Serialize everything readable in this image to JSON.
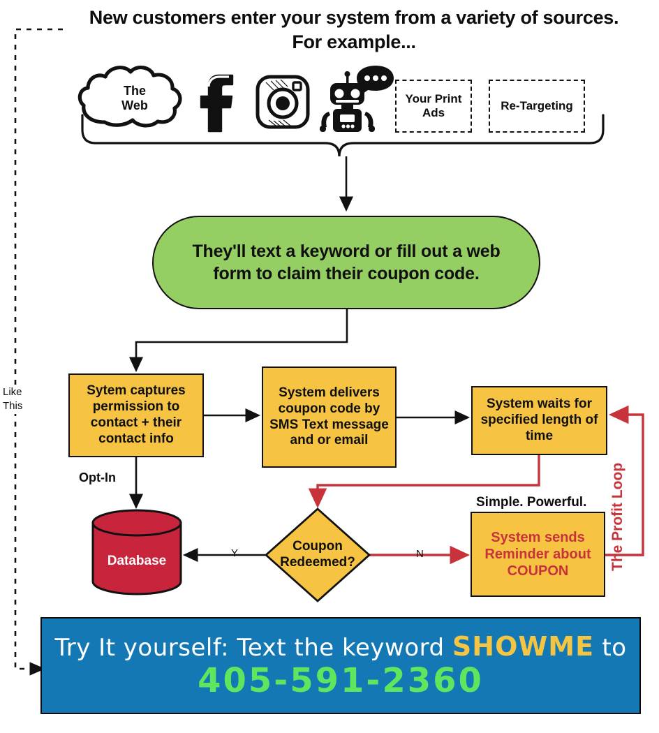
{
  "title": "New customers enter your system from a variety of sources. For example...",
  "sources": {
    "section_name": "customer-sources",
    "items": [
      {
        "id": "the-web",
        "type": "cloud-icon",
        "label": "The\nWeb"
      },
      {
        "id": "facebook",
        "type": "facebook-icon",
        "label": ""
      },
      {
        "id": "instagram",
        "type": "instagram-icon",
        "label": ""
      },
      {
        "id": "chatbot",
        "type": "chatbot-icon",
        "label": ""
      },
      {
        "id": "print-ads",
        "type": "dashed-box",
        "label": "Your\nPrint Ads"
      },
      {
        "id": "re-targeting",
        "type": "dashed-box",
        "label": "Re-Targeting"
      }
    ],
    "cloud_label_line1": "The",
    "cloud_label_line2": "Web",
    "print_ads_label": "Your Print Ads",
    "retargeting_label": "Re-Targeting"
  },
  "green_step": {
    "text": "They'll text a keyword or fill out a web form to claim their coupon code."
  },
  "process_boxes": [
    {
      "id": "capture",
      "text": "Sytem captures permission to contact + their contact info"
    },
    {
      "id": "deliver",
      "text": "System delivers coupon code by SMS Text message and or email"
    },
    {
      "id": "wait",
      "text": "System waits for specified length of time"
    },
    {
      "id": "reminder",
      "text": "System sends Reminder about COUPON"
    }
  ],
  "boxes": {
    "capture": "Sytem captures permission to contact + their contact info",
    "deliver": "System delivers coupon code by SMS Text message and or email",
    "wait": "System waits for specified length of time",
    "reminder": "System sends Reminder about COUPON"
  },
  "decision": {
    "text": "Coupon Redeemed?",
    "yes_label": "Y",
    "no_label": "N"
  },
  "database": {
    "label": "Database"
  },
  "labels": {
    "opt_in": "Opt-In",
    "simple_powerful": "Simple. Powerful.",
    "like_this": "Like This",
    "profit_loop": "The Profit Loop"
  },
  "cta": {
    "line1_before": "Try It yourself: Text the keyword ",
    "keyword": "SHOWME",
    "line1_after": " to",
    "phone": "405-591-2360"
  },
  "colors": {
    "green": "#95ce63",
    "yellow": "#f6c342",
    "red": "#c8333b",
    "blue": "#1478b4",
    "cta_keyword": "#f4c542",
    "cta_phone": "#5ee65e",
    "outline": "#111111"
  }
}
